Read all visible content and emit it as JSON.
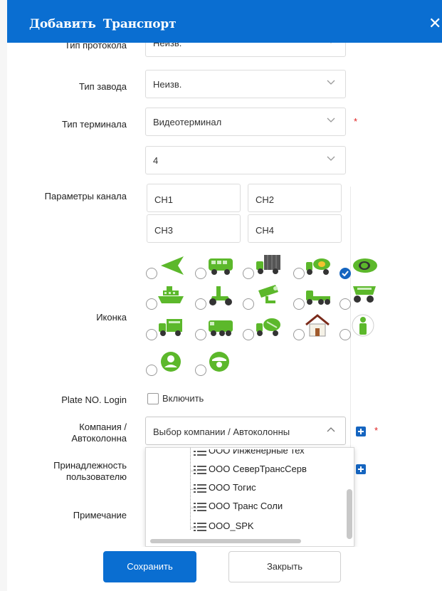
{
  "dialog": {
    "title_left": "Добавить",
    "title_right": "Транспорт",
    "close_glyph": "✕"
  },
  "form": {
    "protocol": {
      "label": "Тип протокола",
      "value": "Неизв."
    },
    "factory": {
      "label": "Тип завода",
      "value": "Неизв."
    },
    "terminal": {
      "label": "Тип терминала",
      "value": "Видеотерминал",
      "required": "*"
    },
    "channel_count": {
      "value": "4"
    },
    "channels": {
      "label": "Параметры канала",
      "items": [
        "CH1",
        "CH2",
        "CH3",
        "CH4"
      ]
    },
    "icon": {
      "label": "Иконка",
      "options": [
        "arrow-icon",
        "bus-icon",
        "cargo-truck-icon",
        "tanker-truck-icon",
        "car-icon",
        "ship-icon",
        "scooter-icon",
        "camera-icon",
        "tow-truck-icon",
        "dump-truck-icon",
        "box-truck-icon",
        "military-truck-icon",
        "mixer-truck-icon",
        "house-icon",
        "person-icon",
        "driver-icon",
        "captain-icon"
      ],
      "selected": "car-icon"
    },
    "plate_login": {
      "label": "Plate NO. Login",
      "checkbox_label": "Включить"
    },
    "company": {
      "label_line1": "Компания /",
      "label_line2": "Автоколонна",
      "placeholder": "Выбор компании / Автоколонны",
      "required": "*"
    },
    "ownership": {
      "label_line1": "Принадлежность",
      "label_line2": "пользователю"
    },
    "note": {
      "label": "Примечание"
    }
  },
  "dropdown": {
    "items": [
      "ООО Инженерные тех",
      "ООО СеверТрансСерв",
      "ООО Тогис",
      "ООО Транс Соли",
      "ООО_SPK"
    ]
  },
  "footer": {
    "save": "Сохранить",
    "close": "Закрыть"
  },
  "colors": {
    "accent": "#0a6ed1",
    "vehicle_green": "#5cb82b",
    "required": "#e02020"
  }
}
